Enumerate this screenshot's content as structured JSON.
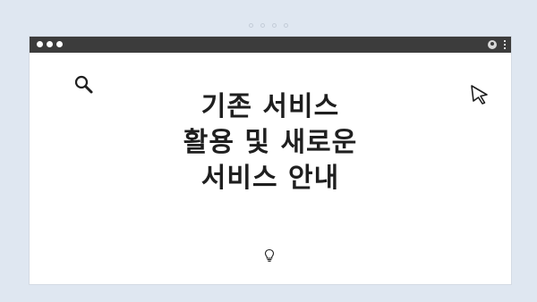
{
  "window": {
    "headline": "기존 서비스\n활용 및 새로운\n서비스 안내"
  },
  "icons": {
    "search": "search-icon",
    "cursor": "cursor-icon",
    "profile": "profile-icon",
    "menu": "kebab-menu-icon",
    "bulb": "lightbulb-icon"
  },
  "colors": {
    "background": "#dfe7f1",
    "titlebar": "#3c3c3c",
    "window": "#ffffff",
    "text": "#1f1f1f"
  }
}
